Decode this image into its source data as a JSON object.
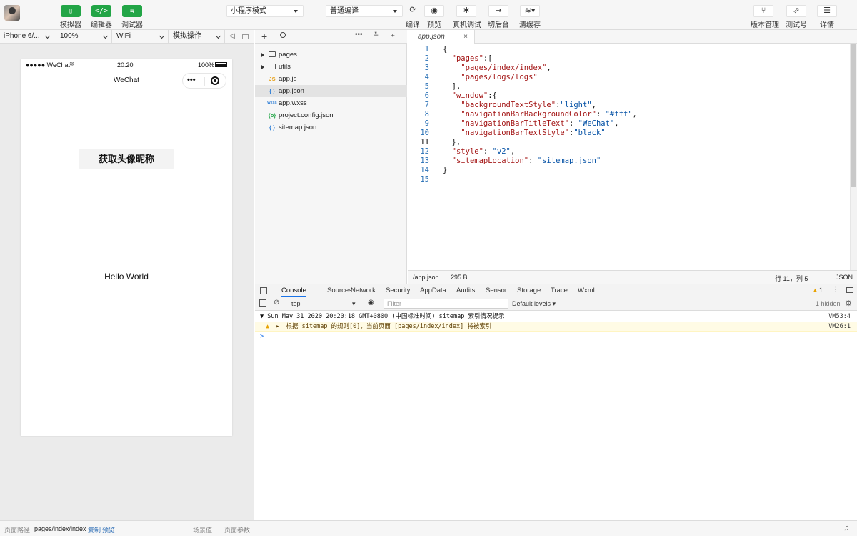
{
  "toolbar": {
    "simulator_label": "模拟器",
    "editor_label": "编辑器",
    "debugger_label": "调试器",
    "simulator_glyph": "▯",
    "editor_glyph": "</>",
    "debugger_glyph": "⇆",
    "mode_select": "小程序模式",
    "compile_select": "普通编译",
    "compile_label": "编译",
    "preview_label": "预览",
    "remote_debug_label": "真机调试",
    "background_label": "切后台",
    "clear_cache_label": "清缓存",
    "version_label": "版本管理",
    "test_label": "测试号",
    "details_label": "详情"
  },
  "simbar": {
    "device": "iPhone 6/...",
    "zoom": "100%",
    "network": "WiFi",
    "sim_ops": "模拟操作"
  },
  "phone": {
    "signal": "●●●●● WeChat",
    "time": "20:20",
    "battery": "100%",
    "nav_title": "WeChat",
    "get_button": "获取头像昵称",
    "hello": "Hello World"
  },
  "bottom": {
    "path_label": "页面路径",
    "path": "pages/index/index",
    "copy": "复制",
    "preview": "预览",
    "scene": "场景值",
    "params": "页面参数"
  },
  "tree": [
    {
      "name": "pages",
      "type": "folder"
    },
    {
      "name": "utils",
      "type": "folder"
    },
    {
      "name": "app.js",
      "type": "js",
      "icon": "JS",
      "color": "#e6a11a"
    },
    {
      "name": "app.json",
      "type": "json",
      "icon": "{ }",
      "color": "#2f7fd6",
      "selected": true
    },
    {
      "name": "app.wxss",
      "type": "wxss",
      "icon": "wxss",
      "color": "#2f7fd6"
    },
    {
      "name": "project.config.json",
      "type": "config",
      "icon": "{o}",
      "color": "#22a546"
    },
    {
      "name": "sitemap.json",
      "type": "json",
      "icon": "{ }",
      "color": "#2f7fd6"
    }
  ],
  "editor": {
    "tab": "app.json",
    "close": "×",
    "lines": [
      "1",
      "2",
      "3",
      "4",
      "5",
      "6",
      "7",
      "8",
      "9",
      "10",
      "11",
      "12",
      "13",
      "14",
      "15"
    ],
    "current_line": 11,
    "code": {
      "l1": "{",
      "l2_key": "\"pages\"",
      "l2_rest": ":[",
      "l3": "\"pages/index/index\"",
      "l3_end": ",",
      "l4": "\"pages/logs/logs\"",
      "l5": "],",
      "l6_key": "\"window\"",
      "l6_rest": ":{",
      "l7_key": "\"backgroundTextStyle\"",
      "l7_val": "\"light\"",
      "l8_key": "\"navigationBarBackgroundColor\"",
      "l8_val": "\"#fff\"",
      "l9_key": "\"navigationBarTitleText\"",
      "l9_val": "\"WeChat\"",
      "l10_key": "\"navigationBarTextStyle\"",
      "l10_val": "\"black\"",
      "l11": "},",
      "l12_key": "\"style\"",
      "l12_val": "\"v2\"",
      "l13_key": "\"sitemapLocation\"",
      "l13_val": "\"sitemap.json\"",
      "l14": "}"
    },
    "status_path": "/app.json",
    "status_size": "295 B",
    "status_pos": "行 11，列 5",
    "status_lang": "JSON"
  },
  "devtools": {
    "tabs": [
      "Console",
      "Sources",
      "Network",
      "Security",
      "AppData",
      "Audits",
      "Sensor",
      "Storage",
      "Trace",
      "Wxml"
    ],
    "active_tab": "Console",
    "warn_count": "1",
    "context": "top",
    "filter_placeholder": "Filter",
    "levels": "Default levels",
    "hidden": "1 hidden",
    "log_group": "▼ Sun May 31 2020 20:20:18 GMT+0800 (中国标准时间) sitemap 索引情况提示",
    "log_group_src": "VM53:4",
    "log_warn": "根据 sitemap 的规则[0]，当前页面 [pages/index/index] 将被索引",
    "log_warn_src": "VM26:1",
    "prompt": ">"
  }
}
